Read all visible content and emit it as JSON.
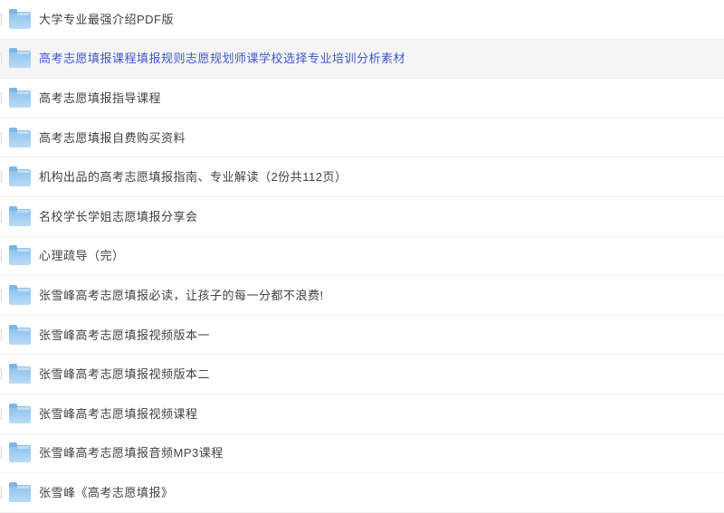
{
  "page": {
    "background": "#ffffff",
    "type": "cloud-drive-folder-listing"
  },
  "colors": {
    "link_blue": "#4257cf",
    "text_normal": "#424242",
    "row_highlight_bg": "#f5f5f5",
    "divider": "#f1f1f1",
    "folder_blue_top": "#8ec1ec",
    "folder_blue_bottom": "#b7dbf6",
    "checkbox_border": "#d9d9d9"
  },
  "icons": {
    "folder": "blue-folder-icon",
    "checkbox": "row-select-checkbox"
  },
  "list": {
    "selected_index": 1,
    "items": [
      {
        "label": "大学专业最强介绍PDF版"
      },
      {
        "label": "高考志愿填报课程填报规则志愿规划师课学校选择专业培训分析素材"
      },
      {
        "label": "高考志愿填报指导课程"
      },
      {
        "label": "高考志愿填报自费购买资料"
      },
      {
        "label": "机构出品的高考志愿填报指南、专业解读（2份共112页）"
      },
      {
        "label": "名校学长学姐志愿填报分享会"
      },
      {
        "label": "心理疏导（完）"
      },
      {
        "label": "张雪峰高考志愿填报必读，让孩子的每一分都不浪费!"
      },
      {
        "label": "张雪峰高考志愿填报视频版本一"
      },
      {
        "label": "张雪峰高考志愿填报视频版本二"
      },
      {
        "label": "张雪峰高考志愿填报视频课程"
      },
      {
        "label": "张雪峰高考志愿填报音频MP3课程"
      },
      {
        "label": "张雪峰《高考志愿填报》"
      }
    ]
  }
}
